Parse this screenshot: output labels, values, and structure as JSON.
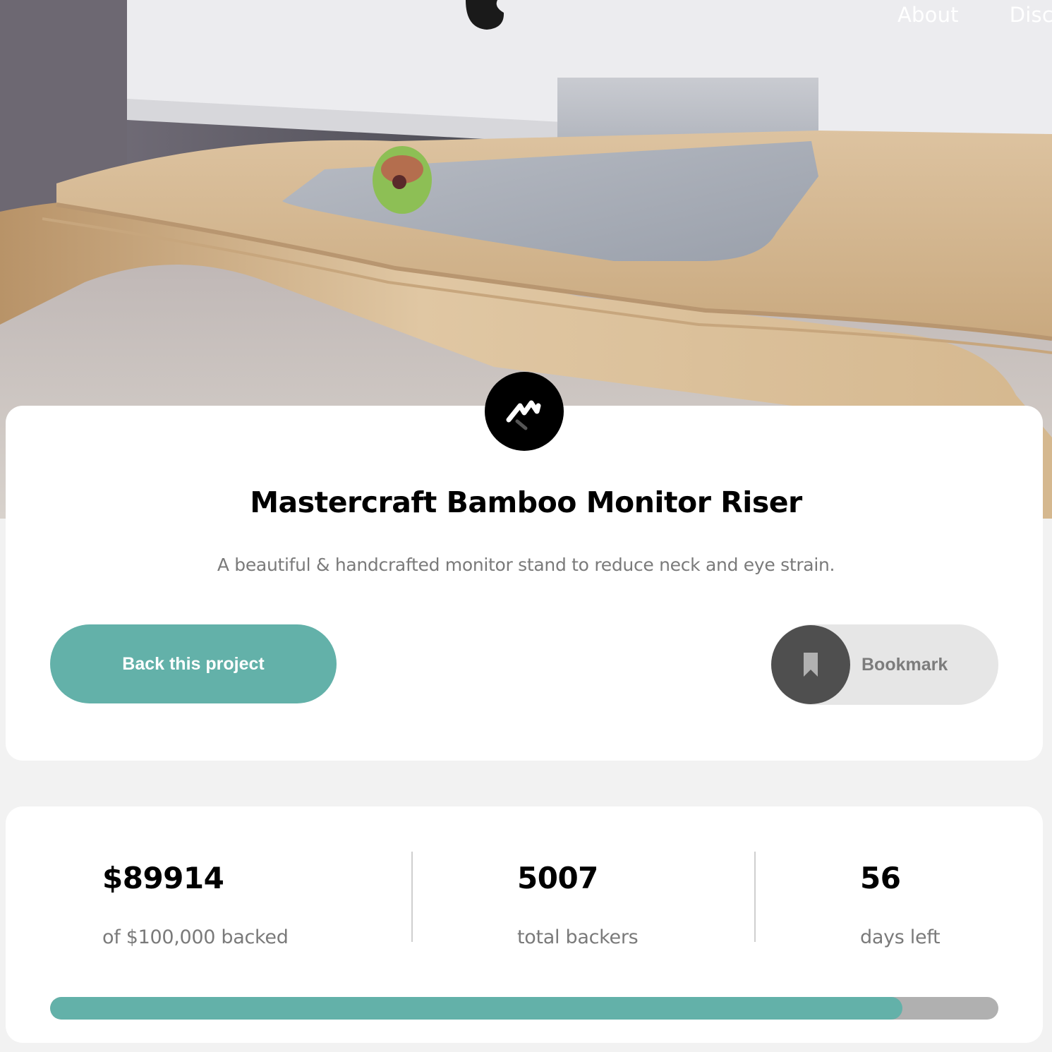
{
  "nav": {
    "items": [
      "About",
      "Disc"
    ]
  },
  "project": {
    "title": "Mastercraft Bamboo Monitor Riser",
    "description": "A beautiful & handcrafted monitor stand to reduce neck and eye strain.",
    "back_label": "Back this project",
    "bookmark_label": "Bookmark"
  },
  "stats": {
    "backed_amount": "$89914",
    "backed_caption": "of $100,000 backed",
    "backers": "5007",
    "backers_caption": "total backers",
    "days": "56",
    "days_caption": "days left",
    "progress_fraction": 0.89914
  },
  "colors": {
    "accent": "#63b1a9",
    "accent_dark": "#3c7f77",
    "progress_track": "#b0b0b0",
    "bookmark_circle": "#4f4f4f"
  },
  "icons": {
    "logo": "mastercraft-logo-icon",
    "bookmark": "bookmark-icon",
    "apple": "apple-logo-icon"
  }
}
